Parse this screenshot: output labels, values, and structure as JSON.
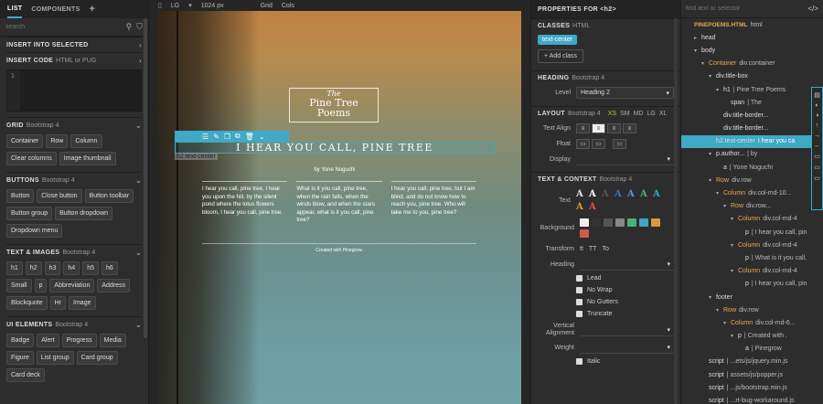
{
  "left_panel": {
    "tabs": [
      "LIST",
      "COMPONENTS"
    ],
    "add_tab": "+",
    "search_placeholder": "search",
    "insert_into_selected": "INSERT INTO SELECTED",
    "insert_code": {
      "title": "INSERT CODE",
      "sub": "HTML or PUG",
      "line": "1"
    },
    "sections": [
      {
        "title": "GRID",
        "sub": "Bootstrap 4",
        "items": [
          "Container",
          "Row",
          "Column",
          "Clear columns",
          "Image thumbnail"
        ]
      },
      {
        "title": "BUTTONS",
        "sub": "Bootstrap 4",
        "items": [
          "Button",
          "Close button",
          "Button toolbar",
          "Button group",
          "Button dropdown",
          "Dropdown menu"
        ]
      },
      {
        "title": "TEXT & IMAGES",
        "sub": "Bootstrap 4",
        "items": [
          "h1",
          "h2",
          "h3",
          "h4",
          "h5",
          "h6",
          "Small",
          "p",
          "Abbreviation",
          "Address",
          "Blockquote",
          "Hr",
          "Image"
        ]
      },
      {
        "title": "UI ELEMENTS",
        "sub": "Bootstrap 4",
        "items": [
          "Badge",
          "Alert",
          "Progress",
          "Media",
          "Figure",
          "List group",
          "Card group",
          "Card deck"
        ]
      }
    ]
  },
  "canvas_toolbar": {
    "device": "LG",
    "width": "1024 px",
    "grid": "Grid",
    "cols": "Cols"
  },
  "page": {
    "the": "The",
    "title": "Pine Tree Poems",
    "h2": "I HEAR YOU CALL, PINE TREE",
    "h2_tag": "h2.text-center",
    "author": "by Yone Noguchi",
    "columns": [
      "I hear you call, pine tree, I hear you upon the hill, by the silent pond where the lotus flowers bloom, I hear you call, pine tree.",
      "What is it you call, pine tree, when the rain falls, when the winds blow, and when the stars appear, what is it you call, pine tree?",
      "I hear you call, pine tree, but I am blind, and do not know how to reach you, pine tree. Who will take me to you, pine tree?"
    ],
    "footer": "Created with Pinegrow."
  },
  "props": {
    "header": "PROPERTIES FOR <h2>",
    "classes_title": "CLASSES",
    "classes_sub": "HTML",
    "class_chip": "text-center",
    "add_class": "+ Add class",
    "heading_title": "HEADING",
    "heading_sub": "Bootstrap 4",
    "level_label": "Level",
    "level_value": "Heading 2",
    "layout_title": "LAYOUT",
    "layout_sub": "Bootstrap 4",
    "breakpoints": [
      "XS",
      "SM",
      "MD",
      "LG",
      "XL"
    ],
    "text_align": "Text Align",
    "float": "Float",
    "display": "Display",
    "text_title": "TEXT & CONTEXT",
    "text_sub": "Bootstrap 4",
    "text_label": "Text",
    "background_label": "Background",
    "transform_label": "Transform",
    "transform_opts": [
      "tt",
      "TT",
      "To"
    ],
    "heading_label": "Heading",
    "checks": [
      "Lead",
      "No Wrap",
      "No Gutters",
      "Truncate"
    ],
    "vertical_alignment": "Vertical Alignment",
    "weight": "Weight",
    "italic": "Italic",
    "text_colors": [
      "#dddddd",
      "#ffffff",
      "#555555",
      "#3b6fb6",
      "#5b8fd6",
      "#4caf7a",
      "#3ba6c4",
      "#d99a3c",
      "#d05a4a"
    ],
    "bg_colors": [
      "#eeeeee",
      "#333333",
      "#555555",
      "#888888",
      "#4caf7a",
      "#3ba6c4",
      "#d99a3c",
      "#d05a4a"
    ]
  },
  "tree": {
    "search_placeholder": "find text or selector",
    "file": "PINEPOEMS.HTML",
    "file_sub": "html",
    "rows": [
      {
        "indent": 0,
        "arr": "",
        "tag": "PINEPOEMS.HTML",
        "txt": "html",
        "file": true
      },
      {
        "indent": 1,
        "arr": "▸",
        "tag": "head",
        "txt": "",
        "white": true
      },
      {
        "indent": 1,
        "arr": "▾",
        "tag": "body",
        "txt": "",
        "white": true
      },
      {
        "indent": 2,
        "arr": "▾",
        "tag": "Container",
        "txt": "div.container"
      },
      {
        "indent": 3,
        "arr": "▾",
        "tag": "div.title-box",
        "txt": "",
        "white": true
      },
      {
        "indent": 4,
        "arr": "▾",
        "tag": "h1",
        "txt": "| Pine Tree Poems",
        "white": true
      },
      {
        "indent": 5,
        "arr": "",
        "tag": "span",
        "txt": "| The",
        "white": true
      },
      {
        "indent": 4,
        "arr": "",
        "tag": "div.title-border...",
        "txt": "",
        "white": true
      },
      {
        "indent": 4,
        "arr": "",
        "tag": "div.title-border...",
        "txt": "",
        "white": true
      },
      {
        "indent": 3,
        "arr": "",
        "tag": "h2.text-center",
        "txt": "I hear you ca",
        "white": true,
        "selected": true
      },
      {
        "indent": 3,
        "arr": "▾",
        "tag": "p.author...",
        "txt": "| by",
        "white": true
      },
      {
        "indent": 4,
        "arr": "",
        "tag": "a",
        "txt": "| Yone Noguchi",
        "white": true
      },
      {
        "indent": 3,
        "arr": "▾",
        "tag": "Row",
        "txt": "div.row"
      },
      {
        "indent": 4,
        "arr": "▾",
        "tag": "Column",
        "txt": "div.col-md-10..."
      },
      {
        "indent": 5,
        "arr": "▾",
        "tag": "Row",
        "txt": "div.row..."
      },
      {
        "indent": 6,
        "arr": "▾",
        "tag": "Column",
        "txt": "div.col-md-4"
      },
      {
        "indent": 7,
        "arr": "",
        "tag": "p",
        "txt": "| I hear you call, pin",
        "white": true
      },
      {
        "indent": 6,
        "arr": "▾",
        "tag": "Column",
        "txt": "div.col-md-4"
      },
      {
        "indent": 7,
        "arr": "",
        "tag": "p",
        "txt": "| What is it you call,",
        "white": true
      },
      {
        "indent": 6,
        "arr": "▾",
        "tag": "Column",
        "txt": "div.col-md-4"
      },
      {
        "indent": 7,
        "arr": "",
        "tag": "p",
        "txt": "| I hear you call, pin",
        "white": true
      },
      {
        "indent": 3,
        "arr": "▾",
        "tag": "footer",
        "txt": "",
        "white": true
      },
      {
        "indent": 4,
        "arr": "▾",
        "tag": "Row",
        "txt": "div.row"
      },
      {
        "indent": 5,
        "arr": "▾",
        "tag": "Column",
        "txt": "div.col-md-6..."
      },
      {
        "indent": 6,
        "arr": "▾",
        "tag": "p",
        "txt": "| Created with .",
        "white": true
      },
      {
        "indent": 7,
        "arr": "",
        "tag": "a",
        "txt": "| Pinegrow",
        "white": true
      },
      {
        "indent": 2,
        "arr": "",
        "tag": "script",
        "txt": "| ...ets/js/jquery.min.js",
        "white": true
      },
      {
        "indent": 2,
        "arr": "",
        "tag": "script",
        "txt": "| assets/js/popper.js",
        "white": true
      },
      {
        "indent": 2,
        "arr": "",
        "tag": "script",
        "txt": "| ...js/bootstrap.min.js",
        "white": true
      },
      {
        "indent": 2,
        "arr": "",
        "tag": "script",
        "txt": "| ...rt-bug-workaround.js",
        "white": true
      }
    ]
  }
}
